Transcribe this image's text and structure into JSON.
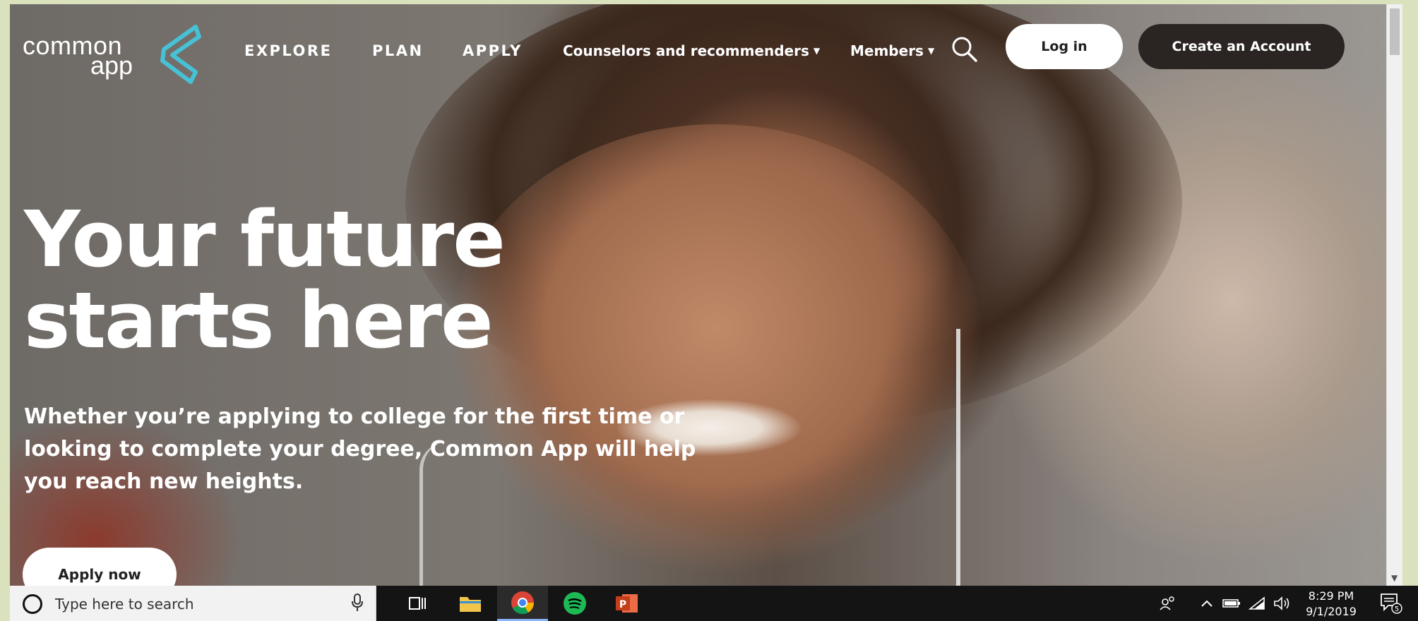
{
  "brand": {
    "logo_line1": "common",
    "logo_line2": "app",
    "accent": "#47c1d6"
  },
  "nav": {
    "links": [
      "EXPLORE",
      "PLAN",
      "APPLY"
    ],
    "dropdowns": [
      "Counselors and recommenders",
      "Members"
    ],
    "search_icon": "search-icon",
    "login_label": "Log in",
    "create_account_label": "Create an Account"
  },
  "hero": {
    "title_line1": "Your future",
    "title_line2": "starts here",
    "subtitle": "Whether you’re applying to college for the first time or looking to complete your degree, Common App will help you reach new heights.",
    "cta_label": "Apply now"
  },
  "taskbar": {
    "search_placeholder": "Type here to search",
    "apps": [
      "task-view-icon",
      "file-explorer-icon",
      "chrome-icon",
      "spotify-icon",
      "powerpoint-icon"
    ],
    "time": "8:29 PM",
    "date": "9/1/2019",
    "notification_count": "5"
  }
}
